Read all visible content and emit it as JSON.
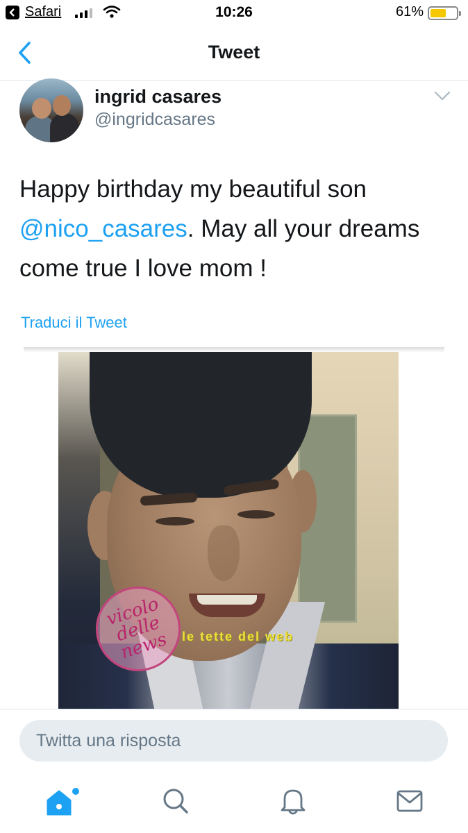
{
  "status_bar": {
    "back_app": "Safari",
    "time": "10:26",
    "battery_percent": "61%",
    "battery_level": 0.61,
    "signal_bars": 3,
    "battery_color": "#f5c800"
  },
  "nav": {
    "title": "Tweet",
    "back_icon": "chevron-left-icon"
  },
  "tweet": {
    "author_name": "ingrid casares",
    "author_handle": "@ingridcasares",
    "text_before": "Happy birthday my beautiful son ",
    "mention": "@nico_casares",
    "text_after": ". May all your dreams come true I love mom !",
    "translate_label": "Traduci il Tweet",
    "watermark_circle": "vicolo delle news",
    "watermark_banner": "le tette del web"
  },
  "reply": {
    "placeholder": "Twitta una risposta"
  },
  "tabs": [
    {
      "name": "home",
      "icon": "home-icon",
      "active": true
    },
    {
      "name": "search",
      "icon": "search-icon",
      "active": false
    },
    {
      "name": "notifications",
      "icon": "bell-icon",
      "active": false
    },
    {
      "name": "messages",
      "icon": "mail-icon",
      "active": false
    }
  ],
  "colors": {
    "accent": "#1da1f2",
    "text": "#14171a",
    "secondary_text": "#657786",
    "reply_field": "#e6ecf0"
  }
}
